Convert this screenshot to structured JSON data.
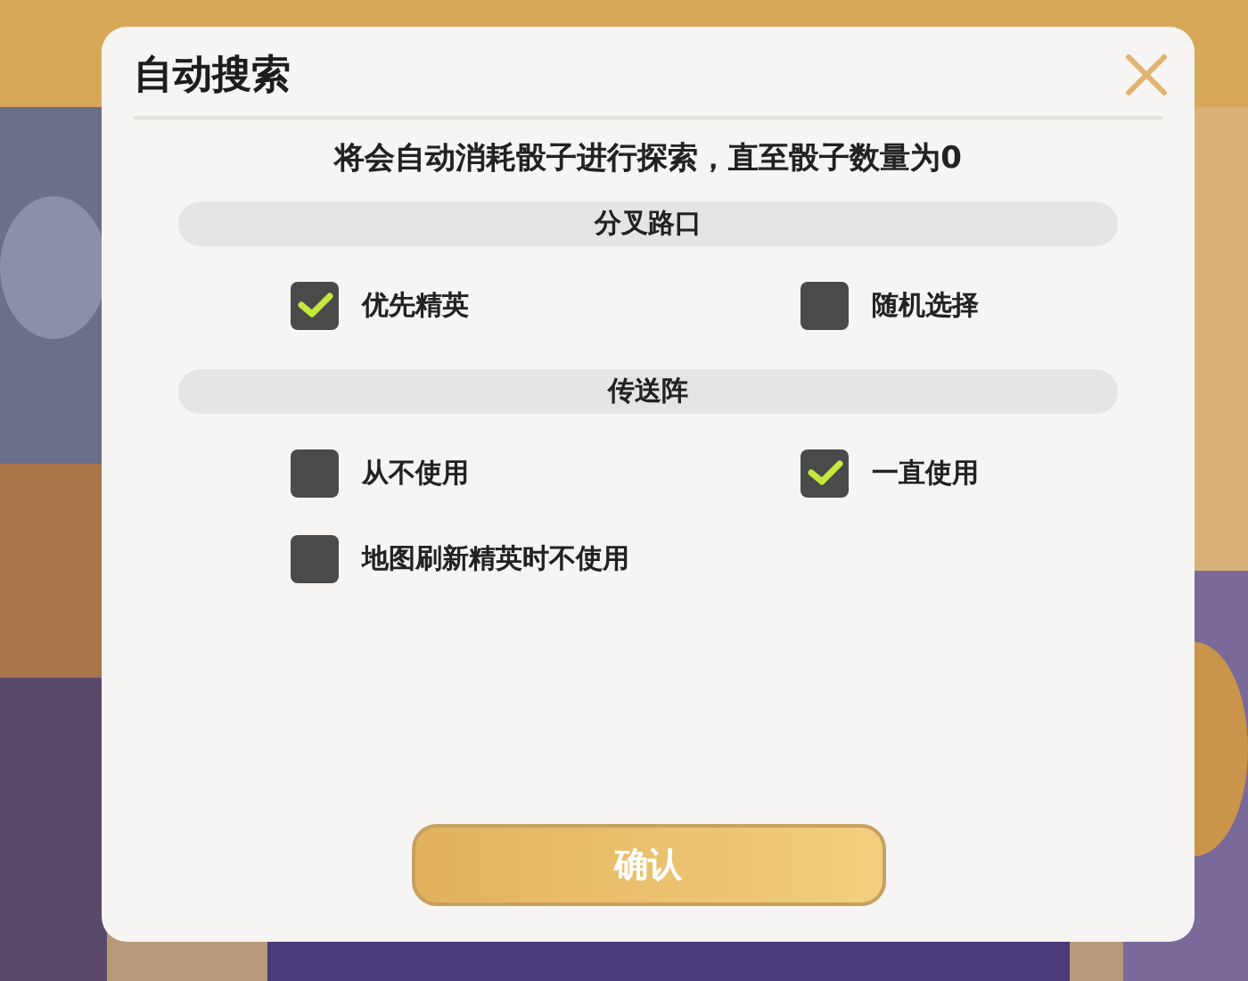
{
  "dialog": {
    "title": "自动搜索",
    "description": "将会自动消耗骰子进行探索，直至骰子数量为0",
    "sections": [
      {
        "title": "分叉路口",
        "options": [
          {
            "label": "优先精英",
            "checked": true
          },
          {
            "label": "随机选择",
            "checked": false
          }
        ]
      },
      {
        "title": "传送阵",
        "options": [
          {
            "label": "从不使用",
            "checked": false
          },
          {
            "label": "一直使用",
            "checked": true
          },
          {
            "label": "地图刷新精英时不使用",
            "checked": false
          }
        ]
      }
    ],
    "confirm_button": "确认"
  }
}
